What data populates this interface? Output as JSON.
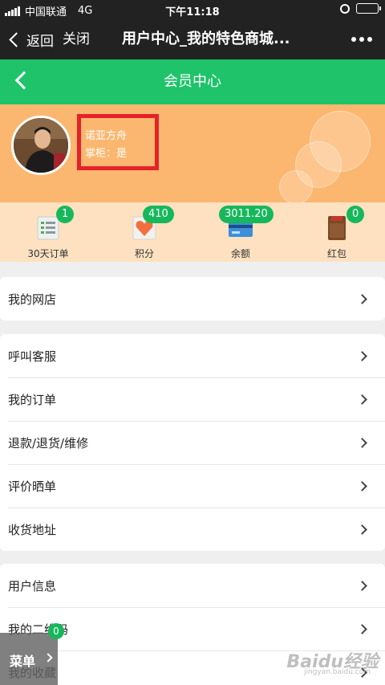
{
  "status_bar": {
    "carrier": "中国联通",
    "network": "4G",
    "time": "下午11:18"
  },
  "nav": {
    "back_label": "返回",
    "close_label": "关闭",
    "title": "用户中心_我的特色商城..."
  },
  "header": {
    "title": "会员中心"
  },
  "profile": {
    "name": "诺亚方舟",
    "keeper": "掌柜：是"
  },
  "stats": [
    {
      "label": "30天订单",
      "badge": "1",
      "icon": "order-list-icon"
    },
    {
      "label": "积分",
      "badge": "410",
      "icon": "heart-points-icon"
    },
    {
      "label": "余额",
      "badge": "3011.20",
      "icon": "card-balance-icon"
    },
    {
      "label": "红包",
      "badge": "0",
      "icon": "red-envelope-icon"
    }
  ],
  "menu": {
    "group1": [
      {
        "label": "我的网店"
      }
    ],
    "group2": [
      {
        "label": "呼叫客服"
      },
      {
        "label": "我的订单"
      },
      {
        "label": "退款/退货/维修"
      },
      {
        "label": "评价晒单"
      },
      {
        "label": "收货地址"
      }
    ],
    "group3": [
      {
        "label": "用户信息"
      },
      {
        "label": "我的二维码"
      },
      {
        "label": "我的收藏"
      }
    ]
  },
  "float_menu": {
    "label": "菜单",
    "badge": "0"
  },
  "watermark": {
    "text": "Baidu经验",
    "sub": "jingyan.baidu.com"
  },
  "colors": {
    "green": "#1ec36a",
    "orange": "#fbb76f",
    "stats_bg": "#fde1c1",
    "red_box": "#e6212a"
  }
}
